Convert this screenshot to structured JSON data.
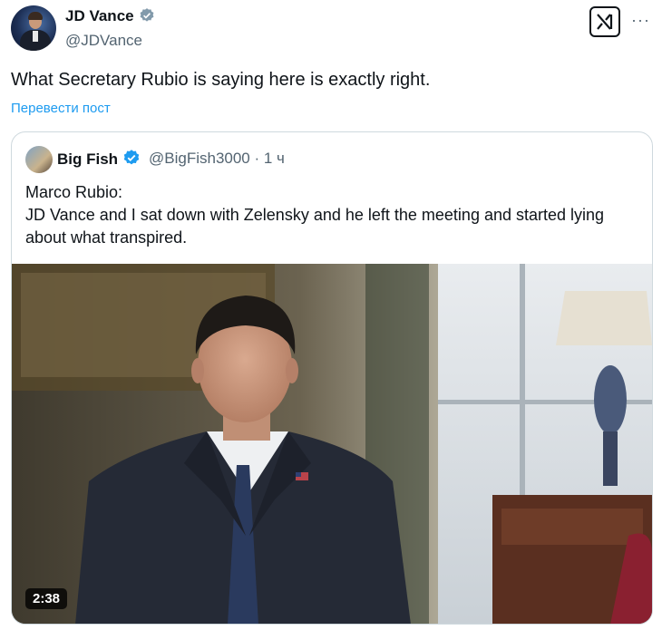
{
  "author": {
    "name": "JD Vance",
    "handle": "@JDVance"
  },
  "tweet": {
    "text": "What Secretary Rubio is saying here is exactly right.",
    "translate_label": "Перевести пост"
  },
  "header": {
    "more_label": "···"
  },
  "quote": {
    "name": "Big Fish",
    "handle": "@BigFish3000 · 1 ч",
    "line1": "Marco Rubio:",
    "line2": "JD Vance and I sat down with Zelensky and he left the meeting and started lying about what transpired.",
    "video_duration": "2:38"
  },
  "colors": {
    "accent": "#1d9bf0",
    "secondary_text": "#536471",
    "border": "#cfd9de"
  }
}
